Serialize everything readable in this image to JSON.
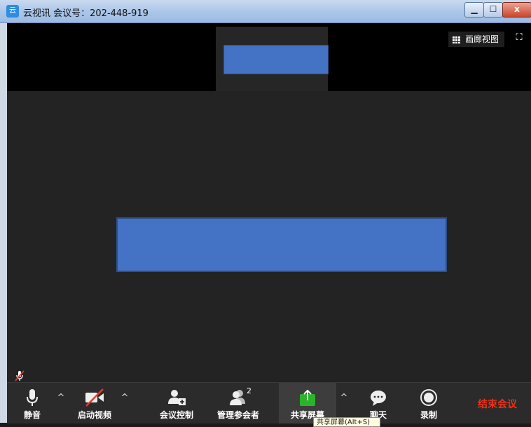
{
  "window": {
    "app_icon_glyph": "云",
    "title": "云视讯 会议号：202-448-919",
    "minimize_glyph": "▁",
    "maximize_glyph": "☐",
    "close_glyph": "x"
  },
  "gallery": {
    "view_label": "画廊视图",
    "fullscreen_glyph": "⛶"
  },
  "toolbar": {
    "mute_label": "静音",
    "start_video_label": "启动视频",
    "meeting_control_label": "会议控制",
    "manage_participants_label": "管理参会者",
    "participant_count": "2",
    "share_screen_label": "共享屏幕",
    "chat_label": "聊天",
    "record_label": "录制",
    "end_meeting_label": "结束会议",
    "caret_glyph": "^"
  },
  "tooltip": {
    "text": "共享屏幕(Alt+S)"
  },
  "colors": {
    "video_placeholder": "#4472c4",
    "share_green": "#2bb42b",
    "end_red": "#e8331b"
  }
}
